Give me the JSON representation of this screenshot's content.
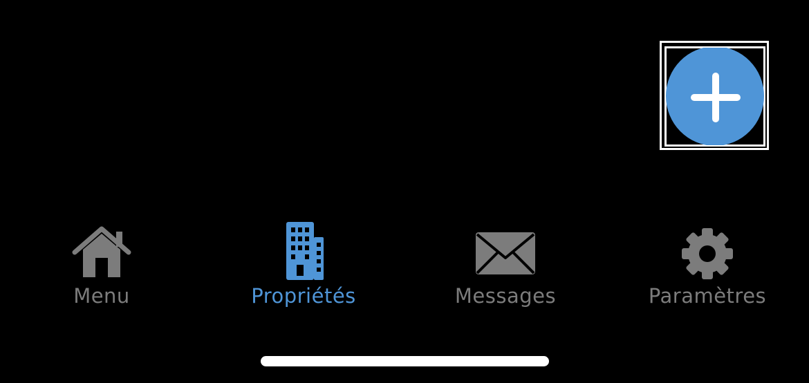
{
  "colors": {
    "background": "#000000",
    "accent": "#4f95d7",
    "inactive": "#7c7c7c",
    "focus_ring": "#ffffff"
  },
  "fab": {
    "icon": "plus-icon"
  },
  "tabbar": {
    "tabs": [
      {
        "label": "Menu",
        "icon": "house-icon",
        "active": false
      },
      {
        "label": "Propriétés",
        "icon": "building-icon",
        "active": true
      },
      {
        "label": "Messages",
        "icon": "envelope-icon",
        "active": false
      },
      {
        "label": "Paramètres",
        "icon": "gear-icon",
        "active": false
      }
    ]
  }
}
